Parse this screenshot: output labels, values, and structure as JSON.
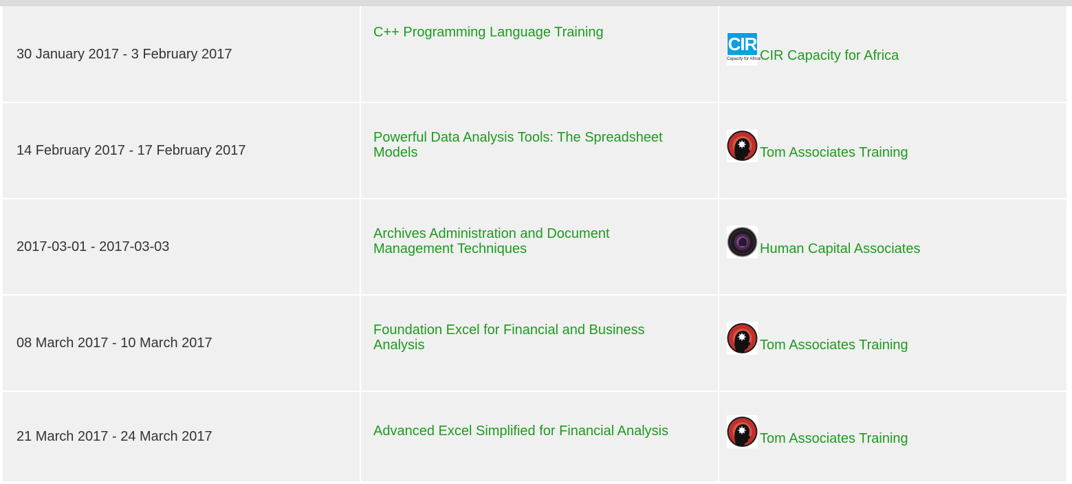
{
  "rows": [
    {
      "date": "30 January 2017 - 3 February 2017",
      "course": "C++ Programming Language Training",
      "org": "CIR Capacity for Africa",
      "logo": "cir-logo",
      "logo_text": "CIR",
      "logo_caption": "Capacity for Africa"
    },
    {
      "date": "14 February 2017 - 17 February 2017",
      "course": "Powerful Data Analysis Tools: The Spreadsheet Models",
      "org": "Tom Associates Training",
      "logo": "tom-associates-logo"
    },
    {
      "date": "2017-03-01 - 2017-03-03",
      "course": "Archives Administration and Document Management Techniques",
      "org": "Human Capital Associates",
      "logo": "human-capital-logo"
    },
    {
      "date": "08 March 2017 - 10 March 2017",
      "course": "Foundation Excel for Financial and Business Analysis",
      "org": "Tom Associates Training",
      "logo": "tom-associates-logo"
    },
    {
      "date": "21 March 2017 - 24 March 2017",
      "course": "Advanced Excel Simplified for Financial Analysis",
      "org": "Tom Associates Training",
      "logo": "tom-associates-logo"
    }
  ],
  "colors": {
    "link": "#1e9a1e",
    "text": "#333333",
    "cell_bg": "#f0f0f0",
    "header_bar": "#dcdcdc"
  }
}
